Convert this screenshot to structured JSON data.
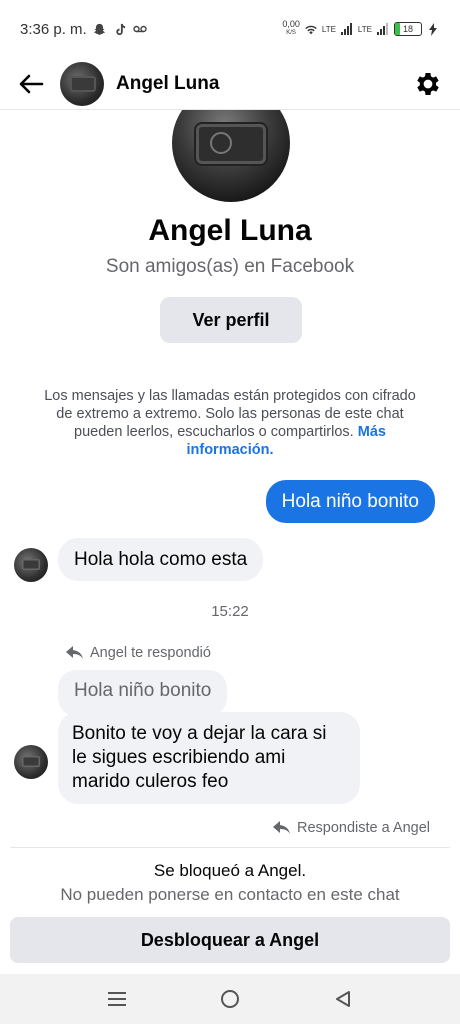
{
  "status_bar": {
    "time": "3:36 p. m.",
    "speed_value": "0,00",
    "speed_unit": "K/S",
    "net1": "LTE",
    "net2": "LTE",
    "battery": "18",
    "battery_level_percent": 18
  },
  "header": {
    "contact_name": "Angel Luna"
  },
  "profile": {
    "name": "Angel Luna",
    "subtitle": "Son amigos(as) en Facebook",
    "view_profile_label": "Ver perfil"
  },
  "encryption": {
    "text": "Los mensajes y las llamadas están protegidos con cifrado de extremo a extremo. Solo las personas de este chat pueden leerlos, escucharlos o compartirlos.",
    "link": "Más información."
  },
  "messages": {
    "outgoing_1": "Hola niño bonito",
    "incoming_1": "Hola hola como esta",
    "timestamp": "15:22",
    "reply_label": "Angel te respondió",
    "quoted": "Hola niño bonito",
    "incoming_2": "Bonito te voy a dejar la cara si le sigues escribiendo ami marido culeros feo",
    "replied_label": "Respondiste a Angel"
  },
  "blocked": {
    "title": "Se bloqueó a Angel.",
    "subtitle": "No pueden ponerse en contacto en este chat",
    "unblock_label": "Desbloquear a Angel"
  },
  "colors": {
    "accent": "#1b74e4",
    "bubble_in": "#f0f2f5",
    "button_bg": "#e4e6eb"
  },
  "icons": {
    "back": "back-arrow-icon",
    "settings": "gear-icon",
    "reply": "reply-icon",
    "nav_menu": "menu-icon",
    "nav_home": "home-circle-icon",
    "nav_back": "triangle-back-icon"
  }
}
